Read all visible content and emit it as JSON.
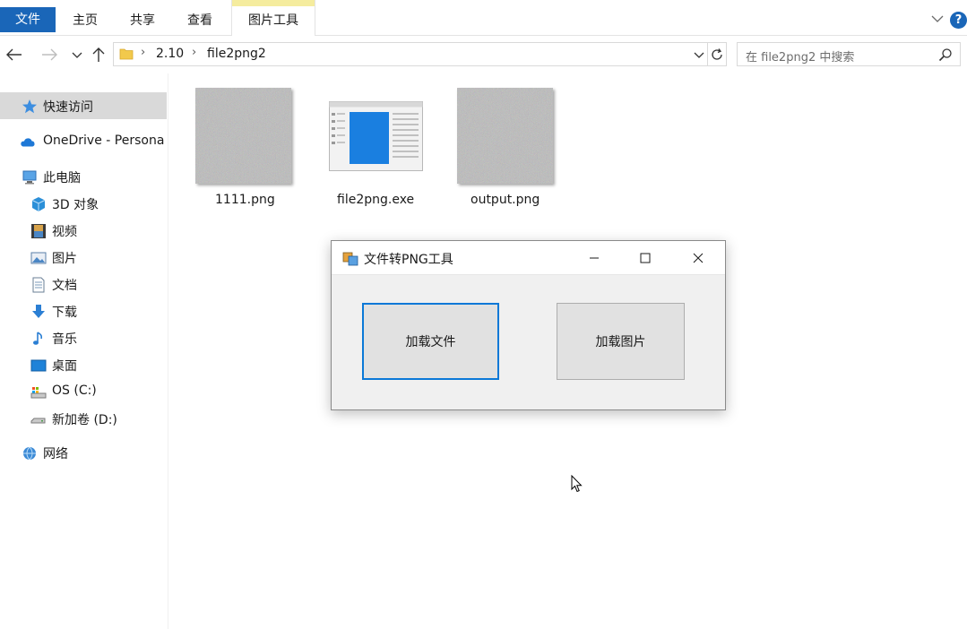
{
  "ribbon": {
    "tabs": [
      "文件",
      "主页",
      "共享",
      "查看",
      "图片工具"
    ],
    "help_label": "?"
  },
  "address": {
    "crumbs": [
      "2.10",
      "file2png2"
    ],
    "search_placeholder": "在 file2png2 中搜索"
  },
  "sidebar": {
    "items": [
      {
        "label": "快速访问",
        "icon": "star-icon"
      },
      {
        "label": "OneDrive - Persona",
        "icon": "cloud-icon"
      },
      {
        "label": "此电脑",
        "icon": "computer-icon"
      },
      {
        "label": "3D 对象",
        "icon": "cube-icon"
      },
      {
        "label": "视频",
        "icon": "film-icon"
      },
      {
        "label": "图片",
        "icon": "picture-icon"
      },
      {
        "label": "文档",
        "icon": "document-icon"
      },
      {
        "label": "下载",
        "icon": "download-icon"
      },
      {
        "label": "音乐",
        "icon": "music-icon"
      },
      {
        "label": "桌面",
        "icon": "desktop-icon"
      },
      {
        "label": "OS (C:)",
        "icon": "drive-icon"
      },
      {
        "label": "新加卷 (D:)",
        "icon": "drive-icon"
      },
      {
        "label": "网络",
        "icon": "network-icon"
      }
    ]
  },
  "files": [
    {
      "name": "1111.png",
      "icon": "noise-image-thumbnail"
    },
    {
      "name": "file2png.exe",
      "icon": "app-window-thumbnail"
    },
    {
      "name": "output.png",
      "icon": "noise-image-thumbnail"
    }
  ],
  "dialog": {
    "title": "文件转PNG工具",
    "load_file_label": "加载文件",
    "load_image_label": "加载图片"
  },
  "colors": {
    "accent": "#1a66b8",
    "focus_border": "#0a78d7",
    "picture_tools_highlight": "#f5ec9e",
    "sidebar_selected": "#d9d9d9"
  }
}
